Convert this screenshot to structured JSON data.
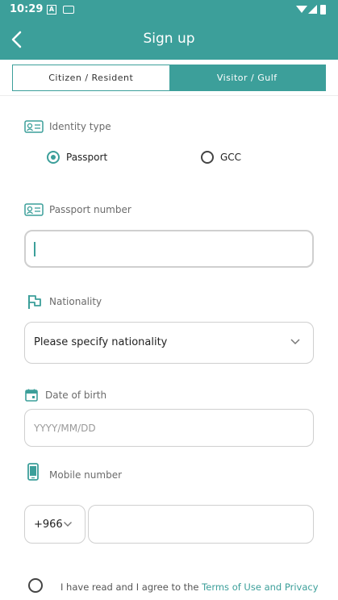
{
  "status_bar": {
    "time": "10:29",
    "notification_icon": "A"
  },
  "header": {
    "title": "Sign up"
  },
  "tabs": [
    {
      "label": "Citizen / Resident",
      "selected": false
    },
    {
      "label": "Visitor / Gulf",
      "selected": true
    }
  ],
  "identity": {
    "label": "Identity type",
    "options": [
      {
        "label": "Passport",
        "selected": true
      },
      {
        "label": "GCC",
        "selected": false
      }
    ]
  },
  "passport": {
    "label": "Passport number",
    "value": ""
  },
  "nationality": {
    "label": "Nationality",
    "value": "Please specify nationality"
  },
  "dob": {
    "label": "Date of birth",
    "placeholder": "YYYY/MM/DD"
  },
  "mobile": {
    "label": "Mobile number",
    "country_code": "+966",
    "value": ""
  },
  "terms": {
    "text": "I have read and I agree to the ",
    "link": "Terms of Use and Privacy"
  },
  "colors": {
    "primary": "#3c9f9a"
  }
}
